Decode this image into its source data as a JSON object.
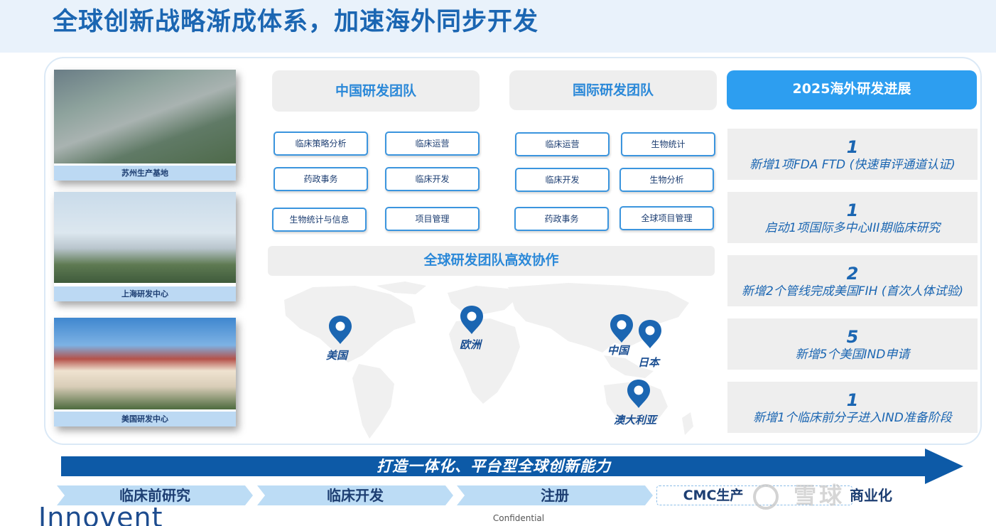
{
  "title": "全球创新战略渐成体系，加速海外同步开发",
  "photos": [
    {
      "caption": "苏州生产基地"
    },
    {
      "caption": "上海研发中心"
    },
    {
      "caption": "美国研发中心"
    }
  ],
  "china_team": {
    "title": "中国研发团队",
    "items": [
      "临床策略分析",
      "临床运营",
      "药政事务",
      "临床开发",
      "生物统计与信息",
      "项目管理"
    ]
  },
  "intl_team": {
    "title": "国际研发团队",
    "items": [
      "临床运营",
      "生物统计",
      "临床开发",
      "生物分析",
      "药政事务",
      "全球项目管理"
    ]
  },
  "collaboration": "全球研发团队高效协作",
  "map_pins": [
    "美国",
    "欧洲",
    "中国",
    "日本",
    "澳大利亚"
  ],
  "progress": {
    "title": "2025海外研发进展",
    "items": [
      {
        "number": "1",
        "text": "新增1项FDA FTD (快速审评通道认证)"
      },
      {
        "number": "1",
        "text": "启动1项国际多中心III期临床研究"
      },
      {
        "number": "2",
        "text": "新增2个管线完成美国FIH (首次人体试验)"
      },
      {
        "number": "5",
        "text": "新增5个美国IND申请"
      },
      {
        "number": "1",
        "text": "新增1个临床前分子进入IND准备阶段"
      }
    ]
  },
  "arrow_text": "打造一体化、平台型全球创新能力",
  "stages": [
    "临床前研究",
    "临床开发",
    "注册",
    "CMC生产",
    "商业化"
  ],
  "watermark": "雪球",
  "logo": "Innovent",
  "footer": "Confidential",
  "colors": {
    "primary": "#1b66b2",
    "accent": "#2d9ef0",
    "dark_blue": "#0d5aa7",
    "light_blue": "#bcdcf5",
    "header_bg": "#e9f2fb",
    "box_gray": "#eeeeee"
  }
}
